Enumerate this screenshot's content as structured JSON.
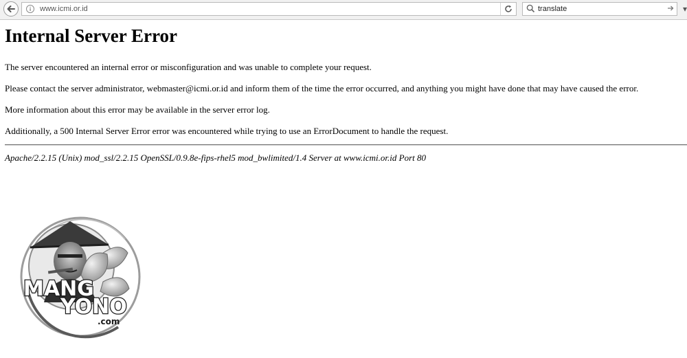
{
  "browser": {
    "url": "www.icmi.or.id",
    "search_value": "translate"
  },
  "page": {
    "title": "Internal Server Error",
    "paragraphs": [
      "The server encountered an internal error or misconfiguration and was unable to complete your request.",
      "Please contact the server administrator, webmaster@icmi.or.id and inform them of the time the error occurred, and anything you might have done that may have caused the error.",
      "More information about this error may be available in the server error log.",
      "Additionally, a 500 Internal Server Error error was encountered while trying to use an ErrorDocument to handle the request."
    ],
    "server_signature": "Apache/2.2.15 (Unix) mod_ssl/2.2.15 OpenSSL/0.9.8e-fips-rhel5 mod_bwlimited/1.4 Server at www.icmi.or.id Port 80"
  },
  "watermark": {
    "line1": "MANG",
    "line2": "YONO",
    "line3": ".com"
  },
  "icons": {
    "back": "back-arrow-icon",
    "info": "info-icon",
    "reload": "reload-icon",
    "search": "search-icon",
    "go": "go-arrow-icon"
  }
}
